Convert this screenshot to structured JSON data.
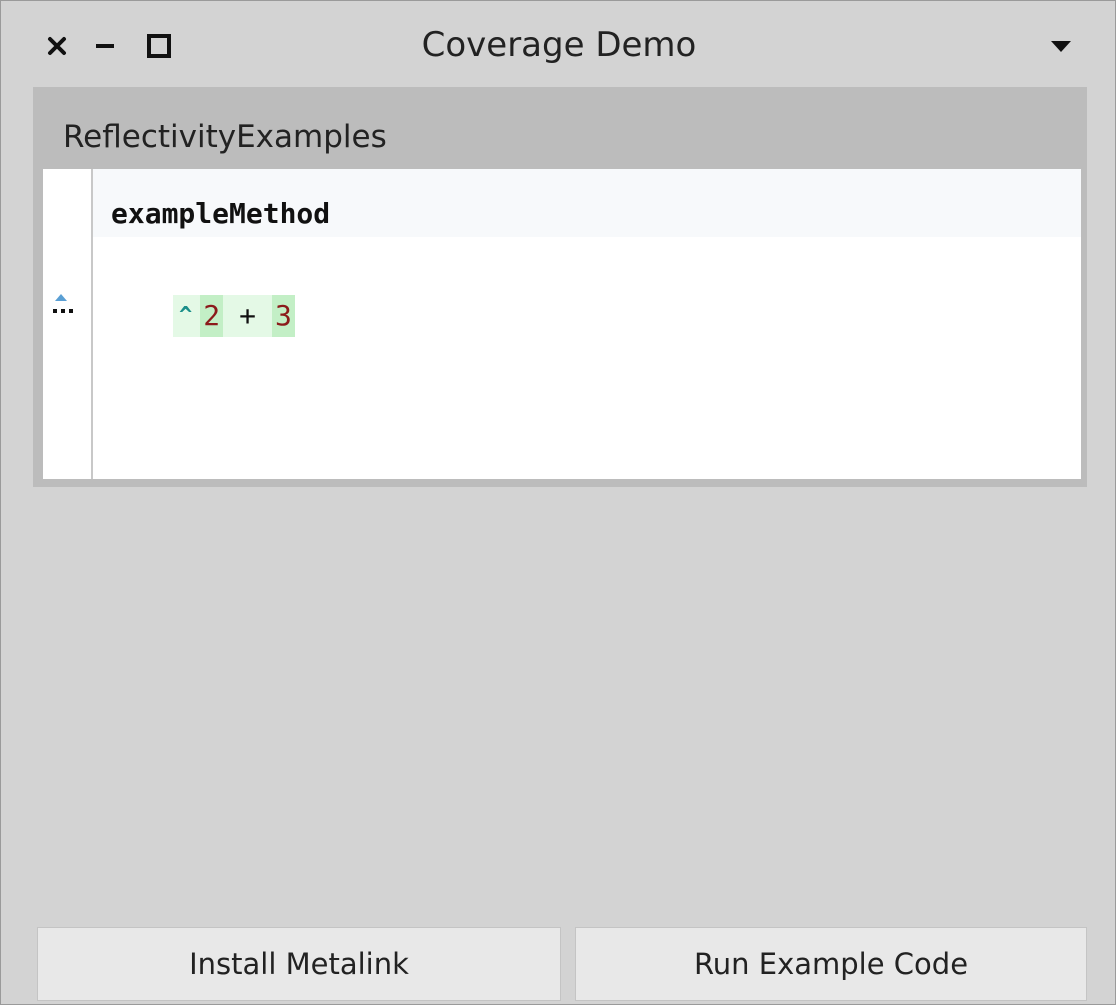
{
  "window": {
    "title": "Coverage Demo",
    "controls": {
      "close_icon": "close-icon",
      "minimize_icon": "minimize-icon",
      "maximize_icon": "maximize-icon",
      "menu_icon": "chevron-down-icon"
    }
  },
  "panel": {
    "class_name": "ReflectivityExamples"
  },
  "editor": {
    "method_name": "exampleMethod",
    "code_tokens": {
      "caret": "^",
      "left_operand": "2",
      "operator": "+",
      "right_operand": "3"
    },
    "gutter_marker_icon": "metalink-marker-icon"
  },
  "buttons": {
    "install_label": "Install Metalink",
    "run_label": "Run Example Code"
  },
  "colors": {
    "window_bg": "#d3d3d3",
    "header_bg": "#bcbcbc",
    "coverage_light": "#e4f9e6",
    "coverage_dark": "#c3efc6",
    "number_color": "#8b1a1a",
    "caret_color": "#1b8f8a"
  }
}
